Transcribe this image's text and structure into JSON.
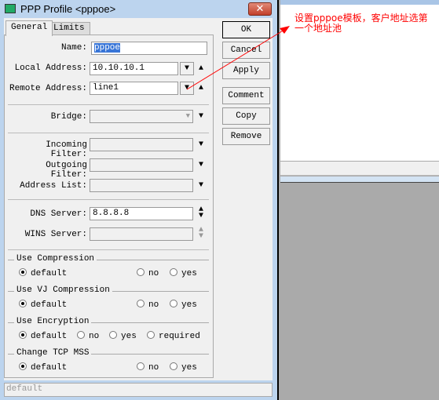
{
  "window": {
    "title": "PPP Profile <pppoe>",
    "close_icon": "close-icon"
  },
  "tabs": [
    {
      "label": "General",
      "active": true
    },
    {
      "label": "Limits",
      "active": false
    }
  ],
  "fields": {
    "name": {
      "label": "Name:",
      "value": "pppoe"
    },
    "local_address": {
      "label": "Local Address:",
      "value": "10.10.10.1"
    },
    "remote_address": {
      "label": "Remote Address:",
      "value": "line1"
    },
    "bridge": {
      "label": "Bridge:",
      "value": ""
    },
    "incoming_filter": {
      "label": "Incoming Filter:",
      "value": ""
    },
    "outgoing_filter": {
      "label": "Outgoing Filter:",
      "value": ""
    },
    "address_list": {
      "label": "Address List:",
      "value": ""
    },
    "dns_server": {
      "label": "DNS Server:",
      "value": "8.8.8.8"
    },
    "wins_server": {
      "label": "WINS Server:",
      "value": ""
    }
  },
  "groups": [
    {
      "title": "Use Compression",
      "options": [
        "default",
        "no",
        "yes"
      ],
      "selected": "default"
    },
    {
      "title": "Use VJ Compression",
      "options": [
        "default",
        "no",
        "yes"
      ],
      "selected": "default"
    },
    {
      "title": "Use Encryption",
      "options": [
        "default",
        "no",
        "yes",
        "required"
      ],
      "selected": "default"
    },
    {
      "title": "Change TCP MSS",
      "options": [
        "default",
        "no",
        "yes"
      ],
      "selected": "default"
    }
  ],
  "buttons": {
    "ok": "OK",
    "cancel": "Cancel",
    "apply": "Apply",
    "comment": "Comment",
    "copy": "Copy",
    "remove": "Remove"
  },
  "status": "default",
  "annotation": {
    "text": "设置pppoe模板，客户地址选第一个地址池",
    "color": "#ff0000"
  }
}
